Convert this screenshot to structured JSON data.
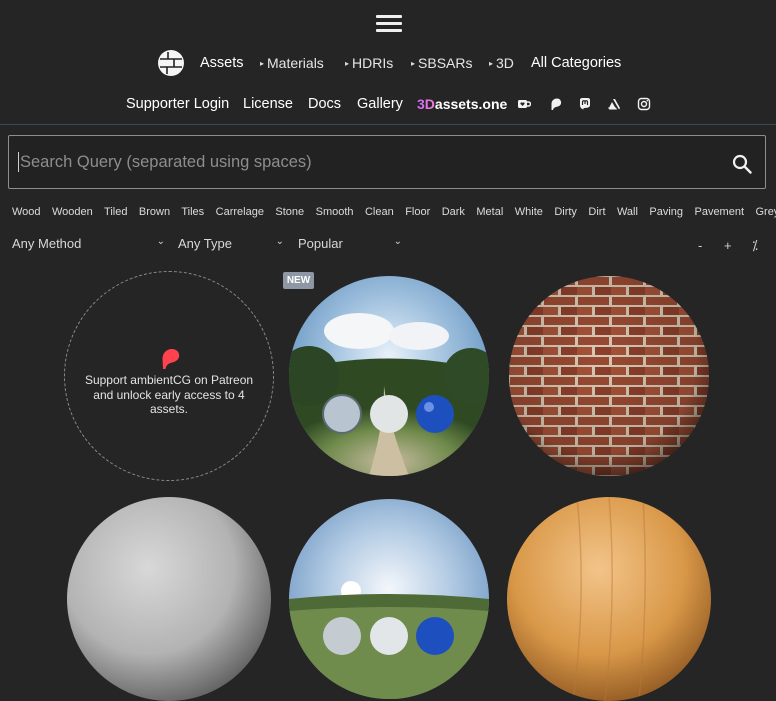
{
  "nav": {
    "assets": "Assets",
    "materials": "Materials",
    "hdris": "HDRIs",
    "sbsars": "SBSARs",
    "three_d": "3D",
    "all_categories": "All Categories",
    "triangle": "▸"
  },
  "nav2": {
    "supporter_login": "Supporter Login",
    "license": "License",
    "docs": "Docs",
    "gallery": "Gallery",
    "brand_prefix": "3D",
    "brand_suffix": "assets.one"
  },
  "search": {
    "placeholder": "Search Query (separated using spaces)",
    "value": ""
  },
  "tags": [
    "Wood",
    "Wooden",
    "Tiled",
    "Brown",
    "Tiles",
    "Carrelage",
    "Stone",
    "Smooth",
    "Clean",
    "Floor",
    "Dark",
    "Metal",
    "White",
    "Dirty",
    "Dirt",
    "Wall",
    "Paving",
    "Pavement",
    "Grey"
  ],
  "filters": {
    "method": "Any Method",
    "type": "Any Type",
    "sort": "Popular",
    "zoom_out": "-",
    "zoom_in": "+",
    "toggle": "⁒"
  },
  "patreon": {
    "text": "Support ambientCG on Patreon and unlock early access to 4 assets."
  },
  "badges": {
    "new": "NEW"
  },
  "icons": {
    "menu": "hamburger-menu-icon",
    "search": "magnifier-icon",
    "patreon": "patreon-icon"
  },
  "colors": {
    "background": "#252526",
    "badge": "#8d98a4",
    "patreon": "#ff424d",
    "brand_gradient": [
      "#c86dff",
      "#ff7ad6"
    ]
  }
}
